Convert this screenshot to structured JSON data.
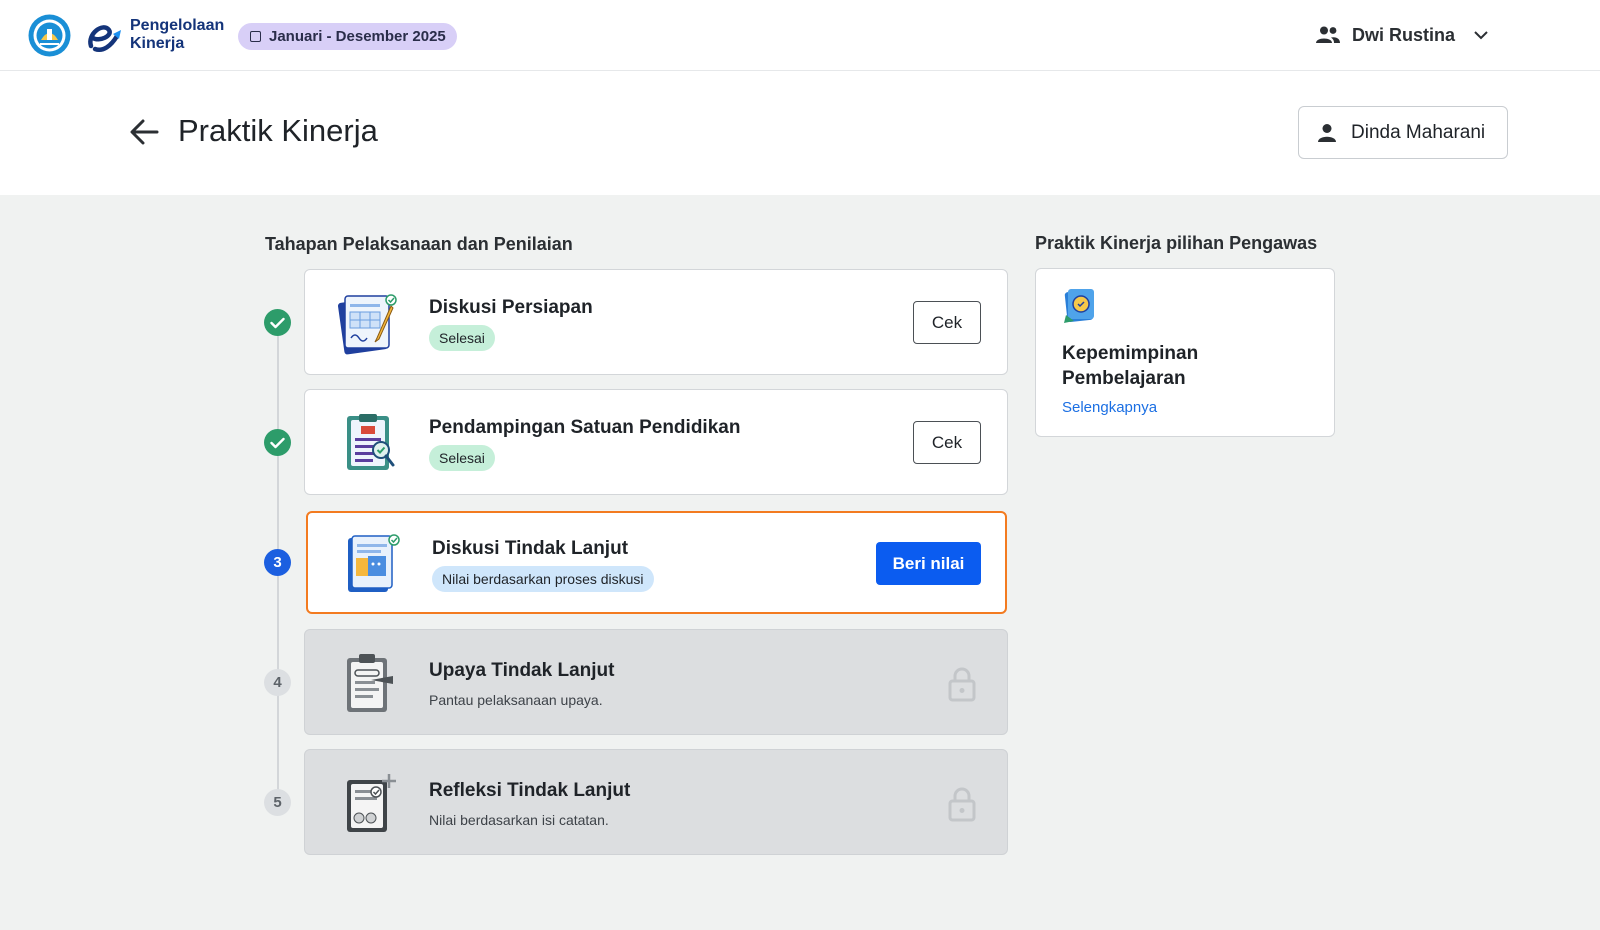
{
  "header": {
    "app_name_line1": "Pengelolaan",
    "app_name_line2": "Kinerja",
    "period": "Januari - Desember 2025",
    "user_name": "Dwi Rustina"
  },
  "page": {
    "title": "Praktik Kinerja",
    "teacher_name": "Dinda Maharani"
  },
  "steps_section": {
    "title": "Tahapan Pelaksanaan dan Penilaian",
    "steps": [
      {
        "number": "1",
        "title": "Diskusi Persiapan",
        "status": "Selesai",
        "state": "done",
        "action": "Cek"
      },
      {
        "number": "2",
        "title": "Pendampingan Satuan Pendidikan",
        "status": "Selesai",
        "state": "done",
        "action": "Cek"
      },
      {
        "number": "3",
        "title": "Diskusi Tindak Lanjut",
        "status": "Nilai berdasarkan proses diskusi",
        "state": "active",
        "action": "Beri nilai"
      },
      {
        "number": "4",
        "title": "Upaya Tindak Lanjut",
        "description": "Pantau pelaksanaan upaya.",
        "state": "locked"
      },
      {
        "number": "5",
        "title": "Refleksi Tindak Lanjut",
        "description": "Nilai berdasarkan isi catatan.",
        "state": "locked"
      }
    ]
  },
  "choice_section": {
    "title": "Praktik Kinerja pilihan Pengawas",
    "card_title": "Kepemimpinan Pembelajaran",
    "link": "Selengkapnya"
  },
  "colors": {
    "primary": "#0b5cf0",
    "success": "#2d9c6a",
    "active_border": "#f37b20",
    "period_badge": "#d8cff7",
    "link": "#1b6fe3"
  },
  "icons": [
    "gov-emblem-icon",
    "app-logo-icon",
    "calendar-icon",
    "users-icon",
    "chevron-down-icon",
    "arrow-left-icon",
    "person-icon",
    "check-icon",
    "lock-icon",
    "document-icon",
    "badge-icon"
  ]
}
